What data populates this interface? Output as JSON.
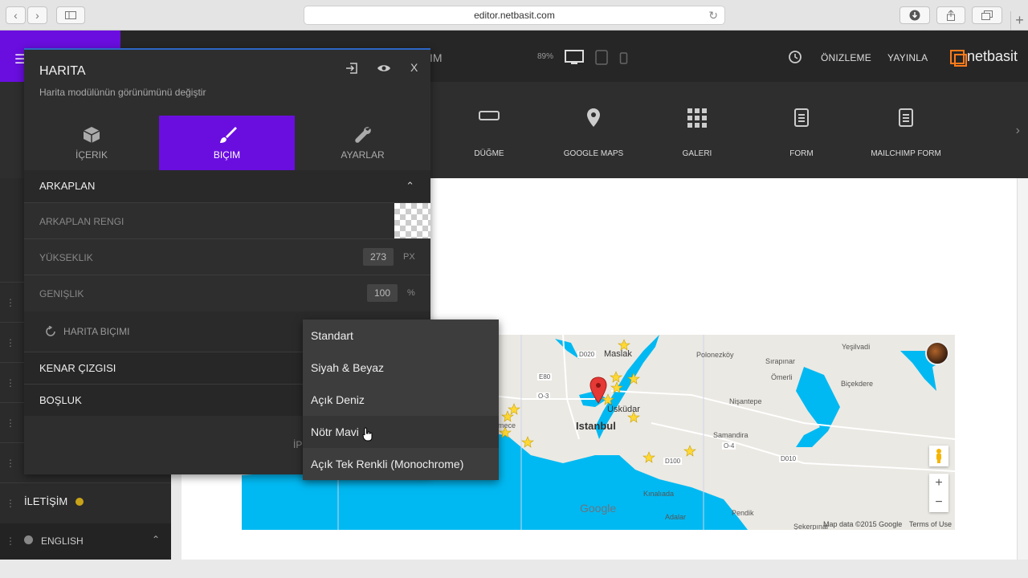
{
  "browser": {
    "url": "editor.netbasit.com"
  },
  "topbar": {
    "partial_title": "IM",
    "zoom": "89%",
    "preview": "ÖNIZLEME",
    "publish": "YAYINLA",
    "logo": "netbasit"
  },
  "modules": [
    {
      "label": "DÜĞME",
      "icon": "button-icon"
    },
    {
      "label": "GOOGLE MAPS",
      "icon": "map-pin-icon"
    },
    {
      "label": "GALERI",
      "icon": "grid-icon"
    },
    {
      "label": "FORM",
      "icon": "form-icon"
    },
    {
      "label": "MAILCHIMP FORM",
      "icon": "form-icon"
    }
  ],
  "panel": {
    "title": "HARITA",
    "subtitle": "Harita modülünün görünümünü değiştir",
    "close": "X",
    "tabs": [
      {
        "label": "İÇERIK",
        "icon": "box-icon"
      },
      {
        "label": "BIÇIM",
        "icon": "brush-icon",
        "active": true
      },
      {
        "label": "AYARLAR",
        "icon": "wrench-icon"
      }
    ],
    "background_section": "ARKAPLAN",
    "bg_color_label": "ARKAPLAN RENGI",
    "height_label": "YÜKSEKLIK",
    "height_value": "273",
    "height_unit": "PX",
    "width_label": "GENIŞLIK",
    "width_value": "100",
    "width_unit": "%",
    "map_style_label": "HARITA BIÇIMI",
    "border_section": "KENAR ÇIZGISI",
    "spacing_section": "BOŞLUK",
    "partial_text": "İP"
  },
  "dropdown": {
    "options": [
      "Standart",
      "Siyah & Beyaz",
      "Açık Deniz",
      "Nötr Mavi",
      "Açık Tek Renkli (Monochrome)"
    ],
    "hovered": "Nötr Mavi"
  },
  "sidebar": {
    "contact": "İLETİŞİM",
    "language": "ENGLISH"
  },
  "map": {
    "labels": {
      "maslak": "Maslak",
      "polonezkoy": "Polonezköy",
      "sirapinar": "Sırapınar",
      "yesilvadi": "Yeşilvadi",
      "omerli": "Ömerli",
      "bicekdere": "Biçekdere",
      "nisantepe": "Nişantepe",
      "istanbul": "Istanbul",
      "uskudar": "Üsküdar",
      "samandira": "Samandira",
      "kinaliada": "Kınalıada",
      "adalar": "Adalar",
      "pendik": "Pendik",
      "sekerpinar": "Şekerpınar",
      "mece": "mece",
      "d020": "D020",
      "e80": "E80",
      "d100": "D100",
      "o3": "O-3",
      "o4": "O-4",
      "d010": "D010"
    },
    "google": "Google",
    "mapdata": "Map data ©2015 Google",
    "terms": "Terms of Use",
    "zoom_in": "+",
    "zoom_out": "−"
  },
  "colors": {
    "accent": "#6a0ee0",
    "water": "#00b9f2",
    "logo": "#ff7a1a"
  }
}
